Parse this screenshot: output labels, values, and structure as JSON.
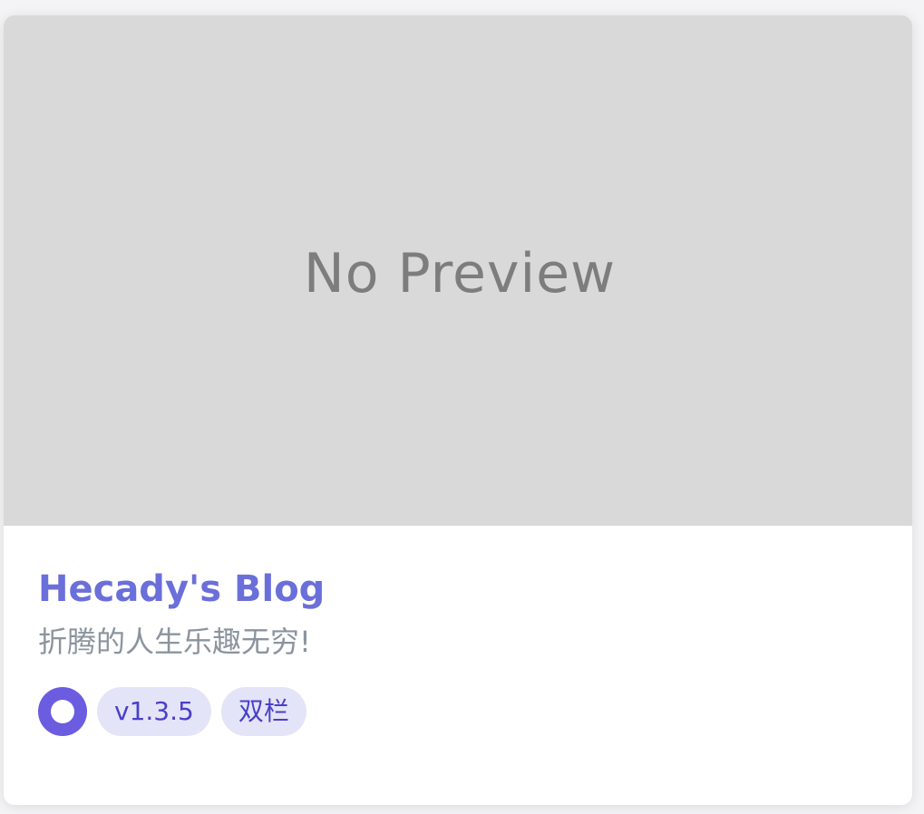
{
  "card": {
    "preview_text": "No Preview",
    "title": "Hecady's Blog",
    "description": "折腾的人生乐趣无穷!",
    "tags": {
      "version": "v1.3.5",
      "layout": "双栏"
    },
    "colors": {
      "title": "#6b6fd9",
      "status_icon": "#6b5ce0",
      "tag_bg": "#e3e4f7",
      "tag_text": "#4a3fc9"
    },
    "status_icon_name": "status-ring-icon"
  }
}
